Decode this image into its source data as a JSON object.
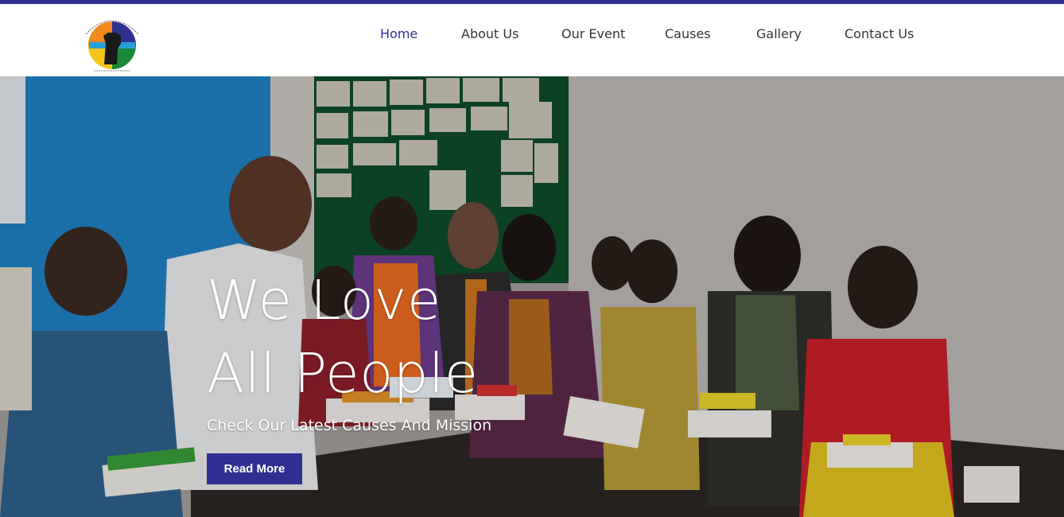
{
  "brand": {
    "logo_icon": "raised-fist-emblem-icon",
    "accent_color": "#2f3192"
  },
  "nav": {
    "items": [
      {
        "label": "Home",
        "active": true
      },
      {
        "label": "About Us",
        "active": false
      },
      {
        "label": "Our Event",
        "active": false
      },
      {
        "label": "Causes",
        "active": false
      },
      {
        "label": "Gallery",
        "active": false
      },
      {
        "label": "Contact Us",
        "active": false
      }
    ]
  },
  "hero": {
    "title_line1": "We Love",
    "title_line2": "All People",
    "subtitle": "Check Our Latest Causes And Mission",
    "cta_label": "Read More"
  }
}
